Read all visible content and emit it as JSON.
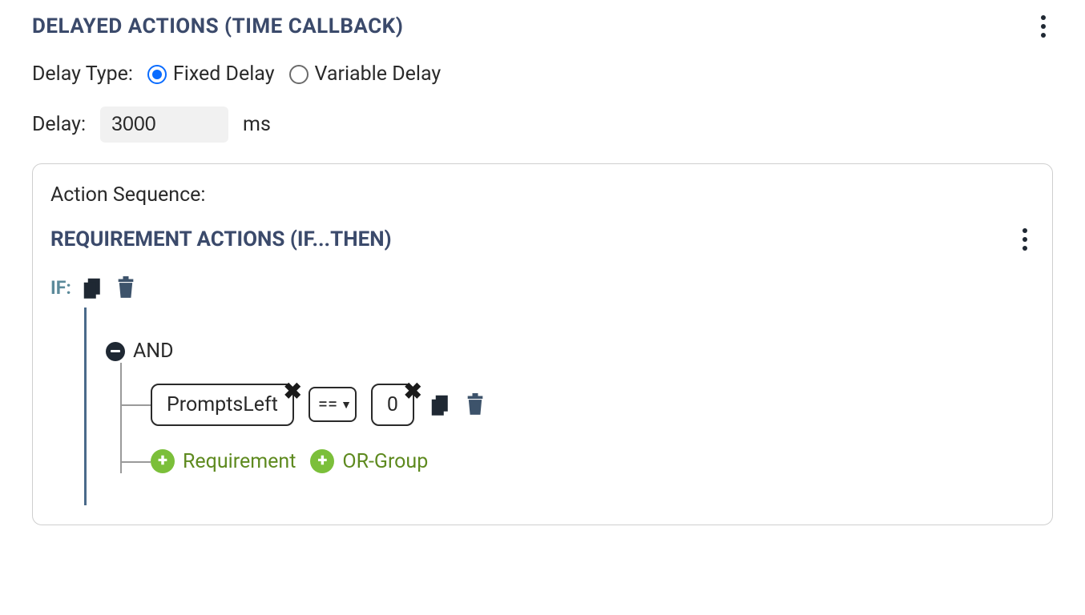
{
  "section": {
    "title": "DELAYED ACTIONS (TIME CALLBACK)"
  },
  "delayType": {
    "label": "Delay Type:",
    "options": {
      "fixed": "Fixed Delay",
      "variable": "Variable Delay"
    },
    "selected": "fixed"
  },
  "delay": {
    "label": "Delay:",
    "value": "3000",
    "unit": "ms"
  },
  "sequence": {
    "label": "Action Sequence:",
    "requirement": {
      "title": "REQUIREMENT ACTIONS (IF...THEN)",
      "ifLabel": "IF:",
      "logic": "AND",
      "condition": {
        "variable": "PromptsLeft",
        "operator": "==",
        "value": "0"
      },
      "addRequirement": "Requirement",
      "addOrGroup": "OR-Group"
    }
  }
}
